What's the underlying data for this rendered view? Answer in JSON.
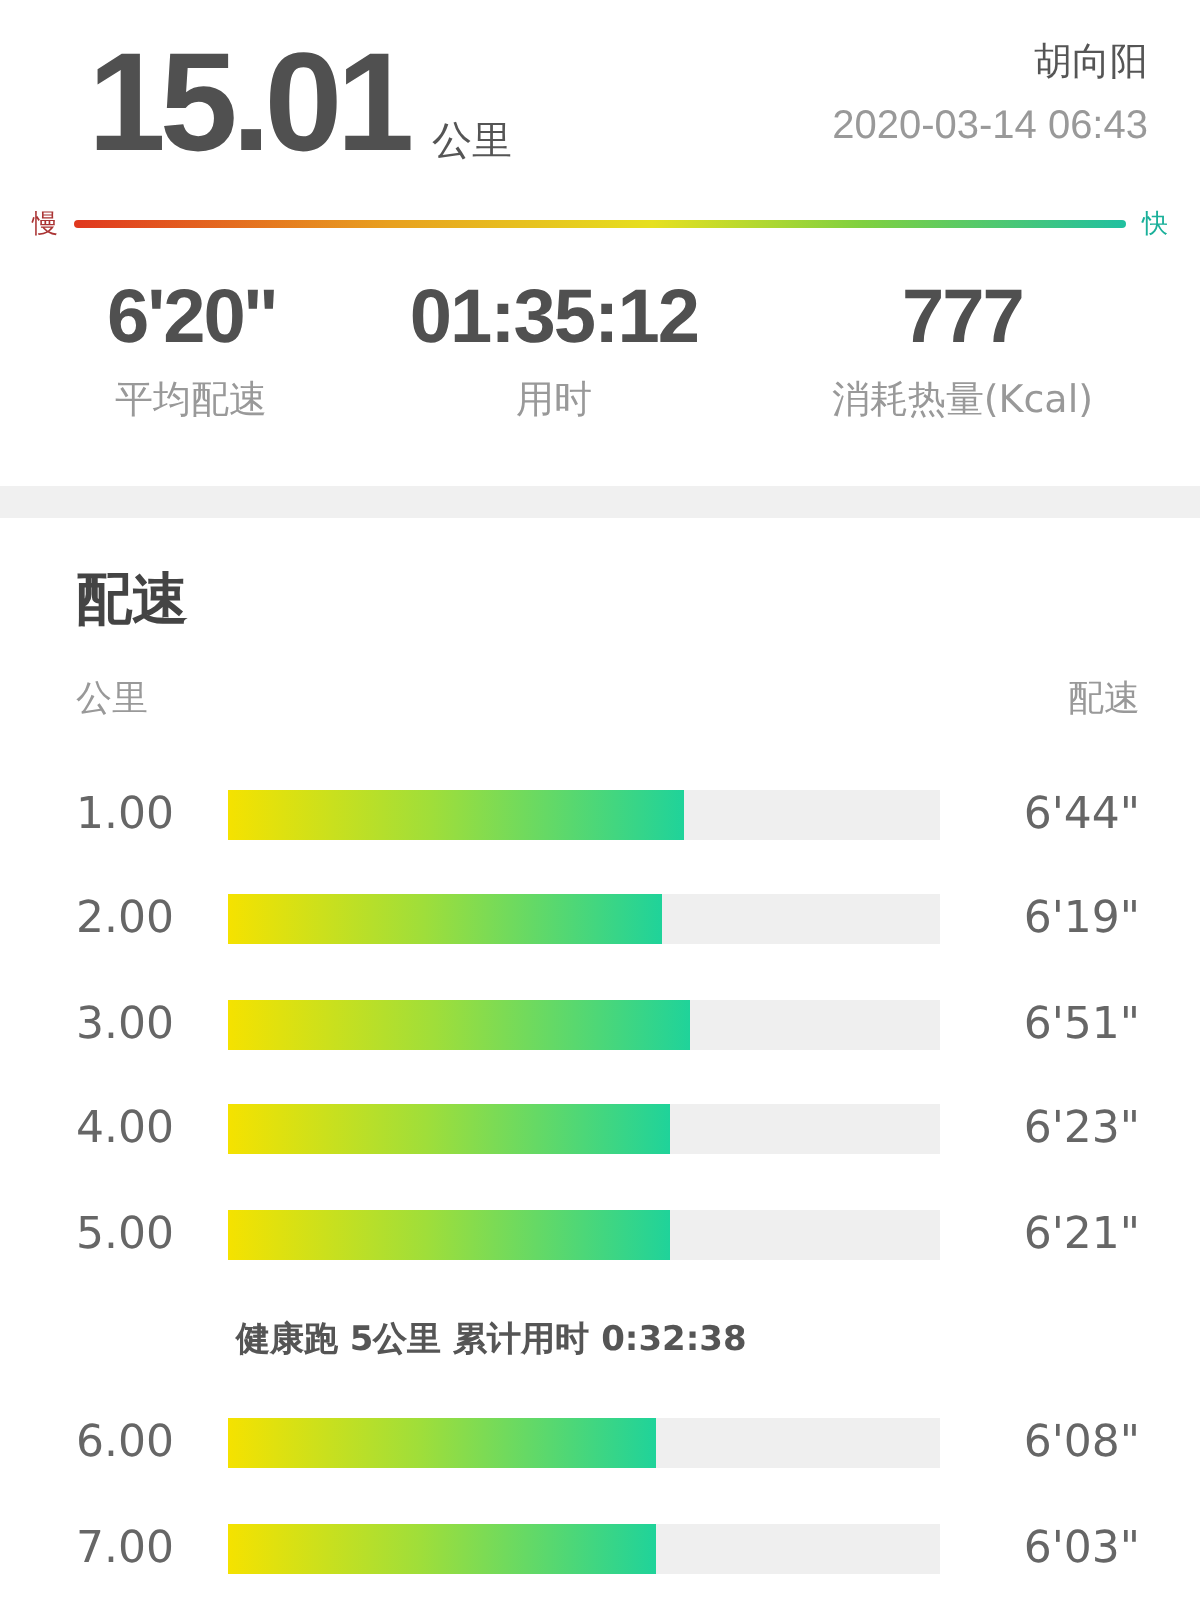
{
  "distance": {
    "value": "15.01",
    "unit": "公里"
  },
  "user": {
    "name": "胡向阳",
    "datetime": "2020-03-14 06:43"
  },
  "speed_scale": {
    "slow_label": "慢",
    "fast_label": "快"
  },
  "stats": [
    {
      "value": "6'20''",
      "label": "平均配速"
    },
    {
      "value": "01:35:12",
      "label": "用时"
    },
    {
      "value": "777",
      "label": "消耗热量(Kcal)"
    }
  ],
  "pace_section": {
    "title": "配速",
    "column_km": "公里",
    "column_pace": "配速",
    "rows": [
      {
        "kind": "split",
        "km": "1.00",
        "level": 0.64,
        "pace": "6'44\""
      },
      {
        "kind": "split",
        "km": "2.00",
        "level": 0.61,
        "pace": "6'19\""
      },
      {
        "kind": "split",
        "km": "3.00",
        "level": 0.65,
        "pace": "6'51\""
      },
      {
        "kind": "split",
        "km": "4.00",
        "level": 0.62,
        "pace": "6'23\""
      },
      {
        "kind": "split",
        "km": "5.00",
        "level": 0.62,
        "pace": "6'21\""
      },
      {
        "kind": "milestone",
        "text": "健康跑 5公里 累计用时 0:32:38"
      },
      {
        "kind": "split",
        "km": "6.00",
        "level": 0.6,
        "pace": "6'08\""
      },
      {
        "kind": "split",
        "km": "7.00",
        "level": 0.6,
        "pace": "6'03\""
      }
    ]
  }
}
